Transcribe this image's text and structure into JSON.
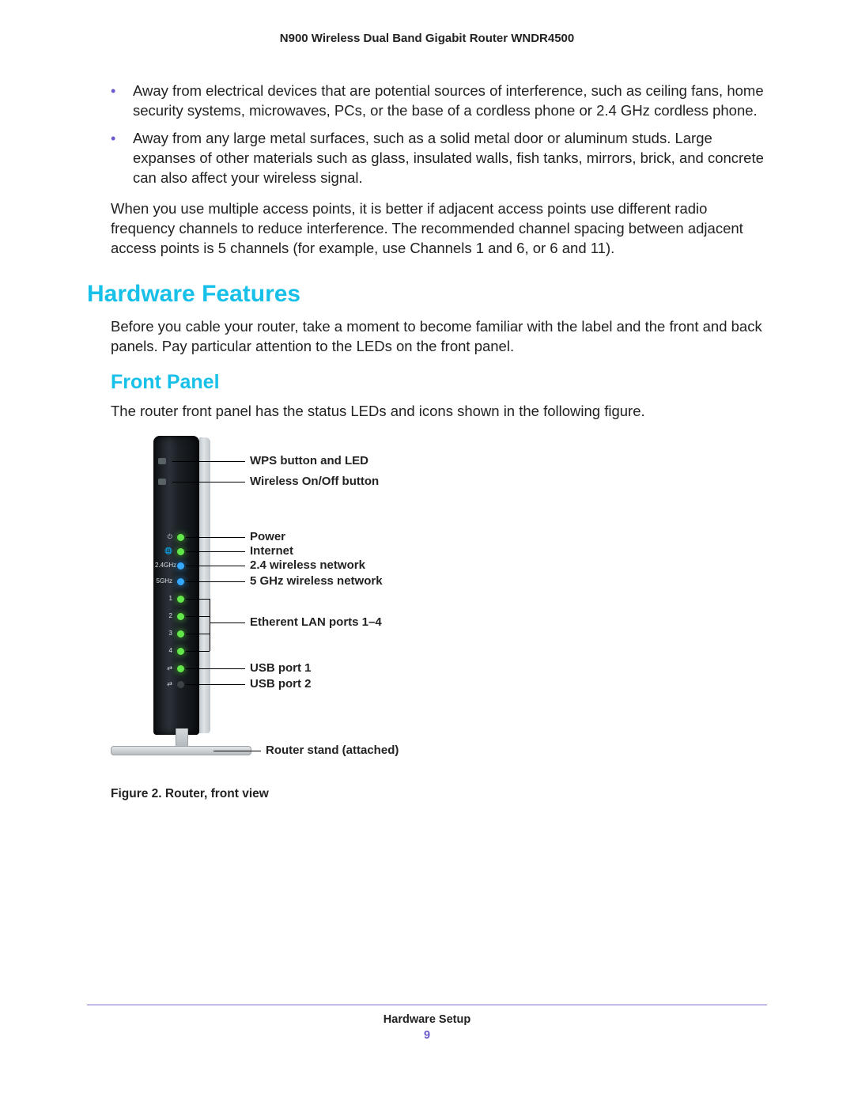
{
  "doc_title": "N900 Wireless Dual Band Gigabit Router WNDR4500",
  "bullets": [
    "Away from electrical devices that are potential sources of interference, such as ceiling fans, home security systems, microwaves, PCs, or the base of a cordless phone or 2.4 GHz cordless phone.",
    "Away from any large metal surfaces, such as a solid metal door or aluminum studs. Large expanses of other materials such as glass, insulated walls, fish tanks, mirrors, brick, and concrete can also affect your wireless signal."
  ],
  "paragraph_after_bullets": "When you use multiple access points, it is better if adjacent access points use different radio frequency channels to reduce interference. The recommended channel spacing between adjacent access points is 5 channels (for example, use Channels 1 and 6, or 6 and 11).",
  "section_heading": "Hardware Features",
  "section_intro": "Before you cable your router, take a moment to become familiar with the label and the front and back panels. Pay particular attention to the LEDs on the front panel.",
  "subsection_heading": "Front Panel",
  "subsection_intro": "The router front panel has the status LEDs and icons shown in the following figure.",
  "callouts": {
    "wps": "WPS button and LED",
    "wifi_btn": "Wireless On/Off button",
    "power": "Power",
    "internet": "Internet",
    "w24": "2.4 wireless network",
    "w5": "5 GHz wireless network",
    "lan": "Etherent LAN ports 1–4",
    "usb1": "USB port 1",
    "usb2": "USB port 2",
    "stand": "Router stand (attached)"
  },
  "panel_markers": {
    "power_icon": "⏻",
    "internet_icon": "🌐",
    "band24": "2.4GHz",
    "band5": "5GHz",
    "lan1": "1",
    "lan2": "2",
    "lan3": "3",
    "lan4": "4",
    "usb": "⇄",
    "usb2": "⇄"
  },
  "figure_caption": "Figure 2. Router, front view",
  "footer_title": "Hardware Setup",
  "page_number": "9"
}
